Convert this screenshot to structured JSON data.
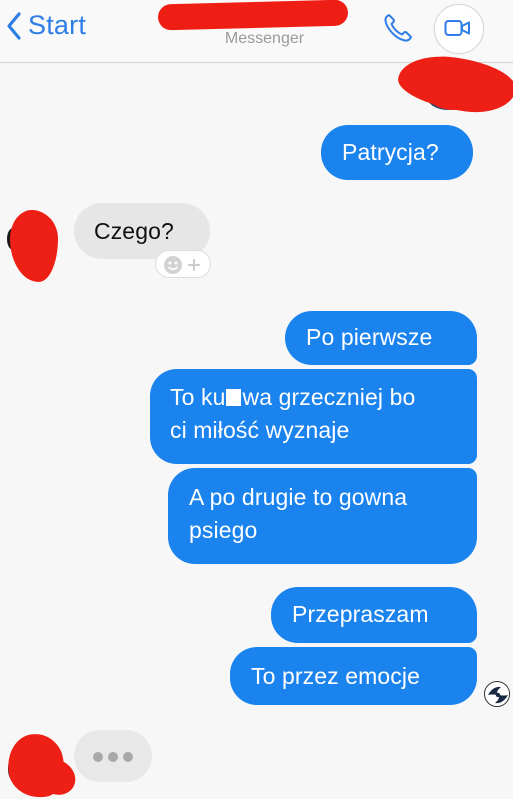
{
  "header": {
    "back_label": "Start",
    "subtitle": "Messenger",
    "call_icon": "phone-icon",
    "video_icon": "video-camera-icon",
    "accent_color": "#2f7ee8"
  },
  "messages": {
    "patrycja": "Patrycja?",
    "czego": "Czego?",
    "po_pierwsze": "Po pierwsze",
    "kuwa_line1_pre": "To ku",
    "kuwa_line1_post": "wa grzeczniej bo",
    "kuwa_line2": "ci miłość wyznaje",
    "drugie_line1": "A po drugie to gowna",
    "drugie_line2": "psiego",
    "przepraszam": "Przepraszam",
    "emocje": "To przez emocje"
  },
  "colors": {
    "outgoing_bubble": "#1a83ee",
    "incoming_bubble": "#e6e6e6",
    "redaction": "#ee2016"
  },
  "icons": {
    "reaction": "add-reaction-icon",
    "typing": "typing-indicator-icon"
  }
}
